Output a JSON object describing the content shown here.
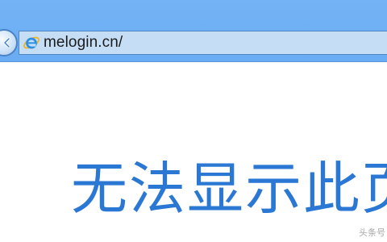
{
  "browser": {
    "address_bar": {
      "url": "melogin.cn/",
      "icon": "internet-explorer-icon"
    },
    "back_button": {
      "icon": "back-arrow-icon"
    },
    "chrome_color": "#6aacf3"
  },
  "error_page": {
    "title": "无法显示此页",
    "title_color": "#2a78d4"
  },
  "watermark": {
    "text": "头条号"
  }
}
